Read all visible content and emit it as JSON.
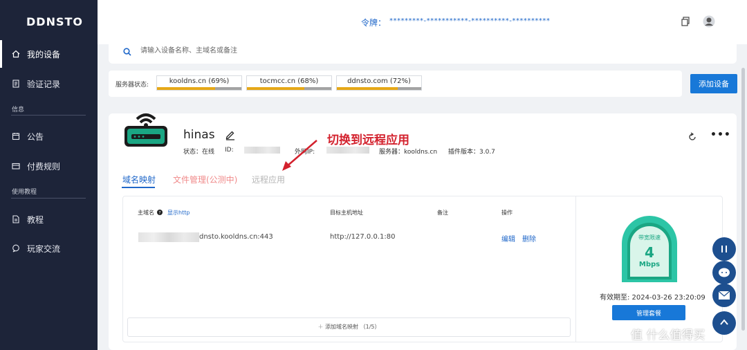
{
  "sidebar": {
    "brand": "DDNSTO",
    "items": [
      {
        "label": "我的设备",
        "icon": "home-icon"
      },
      {
        "label": "验证记录",
        "icon": "document-icon"
      },
      {
        "label": "公告",
        "icon": "calendar-icon"
      },
      {
        "label": "付费规则",
        "icon": "card-icon"
      },
      {
        "label": "教程",
        "icon": "file-icon"
      },
      {
        "label": "玩家交流",
        "icon": "chat-icon"
      }
    ],
    "sections": [
      "信息",
      "使用教程"
    ]
  },
  "header": {
    "token_label": "令牌：",
    "token_value": "*********-***********-**********-**********"
  },
  "search": {
    "placeholder": "请输入设备名称、主域名或备注"
  },
  "server_status": {
    "label": "服务器状态:",
    "servers": [
      {
        "name": "kooldns.cn (69%)",
        "load": 0.69
      },
      {
        "name": "tocmcc.cn (68%)",
        "load": 0.68
      },
      {
        "name": "ddnsto.com (72%)",
        "load": 0.72
      }
    ],
    "add_device_label": "添加设备"
  },
  "device": {
    "name": "hinas",
    "status_label": "状态：在线",
    "id_label": "ID:",
    "ip_label": "外网IP:",
    "server_label": "服务器：kooldns.cn",
    "plugin_label": "插件版本：3.0.7",
    "annotation": "切换到远程应用",
    "tabs": [
      "域名映射",
      "文件管理(公测中)",
      "远程应用"
    ],
    "table": {
      "headers": {
        "domain": "主域名",
        "show_http": "显示http",
        "target": "目标主机地址",
        "note": "备注",
        "action": "操作"
      },
      "rows": [
        {
          "domain": "dnsto.kooldns.cn:443",
          "target": "http://127.0.0.1:80",
          "note": "",
          "edit": "编辑",
          "delete": "删除"
        }
      ],
      "add_mapping": "添加域名映射 （1/5）"
    },
    "plan": {
      "gauge_title": "带宽限速",
      "gauge_value": "4",
      "gauge_unit": "Mbps",
      "expire": "有效期至: 2024-03-26 23:20:09",
      "manage_label": "管理套餐"
    }
  },
  "watermark": "值 什么值得买",
  "colors": {
    "sidebar": "#1d2439",
    "accent": "#1878d8",
    "annotation": "#d3212d",
    "gauge": "#1aa683"
  }
}
